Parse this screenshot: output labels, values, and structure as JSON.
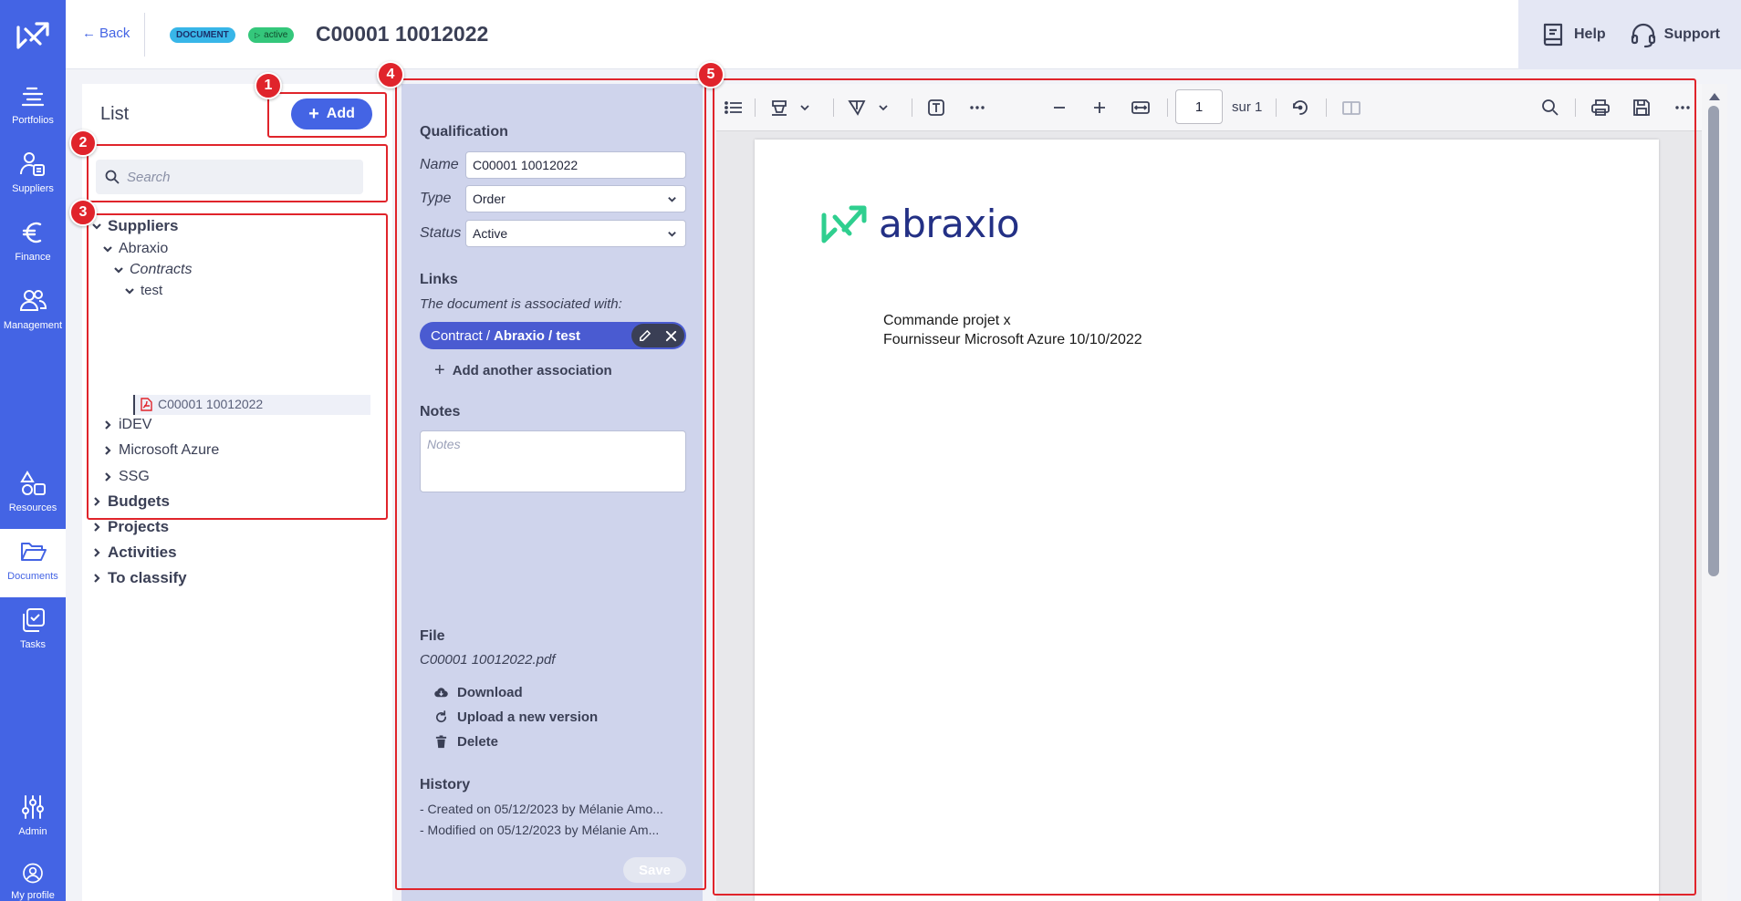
{
  "nav": {
    "items": [
      {
        "label": "Portfolios",
        "icon": "portfolios-icon"
      },
      {
        "label": "Suppliers",
        "icon": "suppliers-icon"
      },
      {
        "label": "Finance",
        "icon": "euro-icon"
      },
      {
        "label": "Management",
        "icon": "users-icon"
      },
      {
        "label": "Resources",
        "icon": "shapes-icon"
      },
      {
        "label": "Documents",
        "icon": "folder-open-icon"
      },
      {
        "label": "Tasks",
        "icon": "tasks-icon"
      },
      {
        "label": "Admin",
        "icon": "sliders-icon"
      },
      {
        "label": "My profile",
        "icon": "user-circle-icon"
      }
    ],
    "active": "Documents"
  },
  "header": {
    "back_label": "Back",
    "badge_type": "DOCUMENT",
    "badge_status": "active",
    "title": "C00001 10012022",
    "help_label": "Help",
    "support_label": "Support"
  },
  "list": {
    "title": "List",
    "add_label": "Add",
    "search_placeholder": "Search",
    "tree": {
      "suppliers": "Suppliers",
      "abraxio": "Abraxio",
      "contracts": "Contracts",
      "test": "test",
      "file": "C00001 10012022",
      "idev": "iDEV",
      "microsoft": "Microsoft Azure",
      "ssg": "SSG",
      "budgets": "Budgets",
      "projects": "Projects",
      "activities": "Activities",
      "to_classify": "To classify"
    }
  },
  "qualification": {
    "section": "Qualification",
    "name_label": "Name",
    "name_value": "C00001 10012022",
    "type_label": "Type",
    "type_value": "Order",
    "status_label": "Status",
    "status_value": "Active",
    "links_section": "Links",
    "links_text": "The document is associated with:",
    "chip_prefix": "Contract /",
    "chip_path": "Abraxio / test",
    "add_association": "Add another association",
    "notes_section": "Notes",
    "notes_placeholder": "Notes",
    "file_section": "File",
    "file_name": "C00001 10012022.pdf",
    "download": "Download",
    "upload": "Upload a new version",
    "delete": "Delete",
    "history_section": "History",
    "history_1": "- Created on 05/12/2023 by Mélanie Amo...",
    "history_2": "- Modified on 05/12/2023 by Mélanie Am...",
    "save_label": "Save"
  },
  "viewer": {
    "page_number": "1",
    "page_of": "sur 1",
    "brand": "abraxio",
    "line_1": "Commande projet x",
    "line_2": "Fournisseur Microsoft Azure 10/10/2022"
  },
  "annotations": [
    "1",
    "2",
    "3",
    "4",
    "5"
  ],
  "colors": {
    "nav": "#4464e4",
    "annotation": "#e0242b",
    "qualification_bg": "#cfd4ec",
    "brand_green": "#2fcf8f",
    "brand_navy": "#233085"
  }
}
